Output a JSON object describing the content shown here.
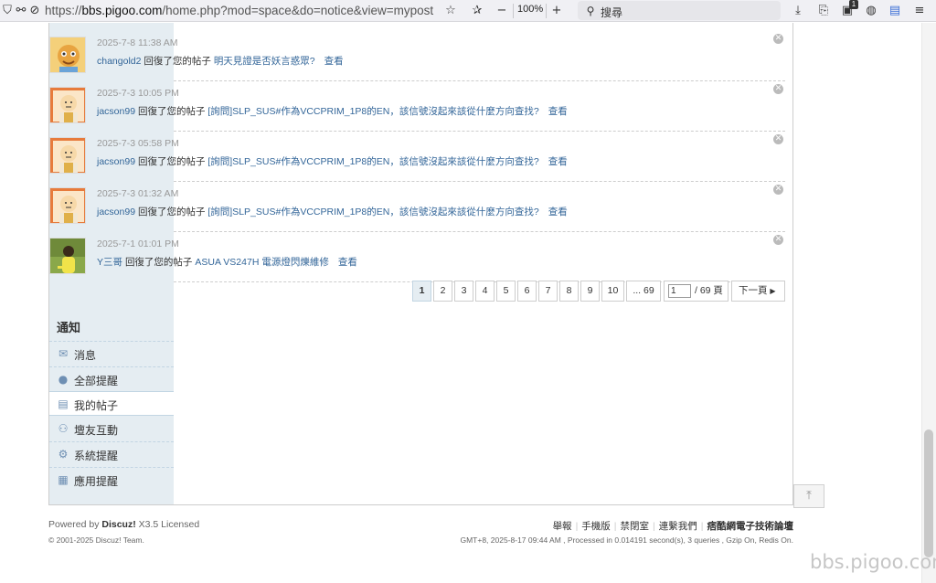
{
  "browser": {
    "url_prefix": "https://",
    "url_host": "bbs.pigoo.com",
    "url_path": "/home.php?mod=space&do=notice&view=mypost",
    "zoom": "100%",
    "search_placeholder": "搜尋",
    "extension_badge": "1"
  },
  "notices": [
    {
      "time": "2025-7-8 11:38 AM",
      "user": "changold2",
      "action": "回復了您的帖子",
      "thread": "明天見證是否妖言惑眾?",
      "view": "查看"
    },
    {
      "time": "2025-7-3 10:05 PM",
      "user": "jacson99",
      "action": "回復了您的帖子",
      "thread": "[詢問]SLP_SUS#作為VCCPRIM_1P8的EN，該信號沒起來該從什麼方向查找?",
      "view": "查看"
    },
    {
      "time": "2025-7-3 05:58 PM",
      "user": "jacson99",
      "action": "回復了您的帖子",
      "thread": "[詢問]SLP_SUS#作為VCCPRIM_1P8的EN，該信號沒起來該從什麼方向查找?",
      "view": "查看"
    },
    {
      "time": "2025-7-3 01:32 AM",
      "user": "jacson99",
      "action": "回復了您的帖子",
      "thread": "[詢問]SLP_SUS#作為VCCPRIM_1P8的EN，該信號沒起來該從什麼方向查找?",
      "view": "查看"
    },
    {
      "time": "2025-7-1 01:01 PM",
      "user": "Y三哥",
      "action": "回復了您的帖子",
      "thread": "ASUA VS247H 電源燈閃爍維修",
      "view": "查看"
    }
  ],
  "pagination": {
    "pages": [
      "1",
      "2",
      "3",
      "4",
      "5",
      "6",
      "7",
      "8",
      "9",
      "10",
      "... 69"
    ],
    "current": "1",
    "input_value": "1",
    "total": "/ 69 頁",
    "next": "下一頁"
  },
  "sidebar": {
    "title": "通知",
    "items": [
      {
        "label": "消息",
        "icon": "envelope-icon"
      },
      {
        "label": "全部提醒",
        "icon": "person-icon"
      },
      {
        "label": "我的帖子",
        "icon": "posts-icon",
        "active": true
      },
      {
        "label": "壇友互動",
        "icon": "interaction-icon"
      },
      {
        "label": "系統提醒",
        "icon": "gear-icon"
      },
      {
        "label": "應用提醒",
        "icon": "calendar-icon"
      }
    ]
  },
  "footer": {
    "powered_prefix": "Powered by",
    "powered_brand": "Discuz!",
    "powered_version": "X3.5 Licensed",
    "copyright": "© 2001-2025 Discuz! Team.",
    "links": [
      "舉報",
      "手機版",
      "禁閉室",
      "連繫我們"
    ],
    "site_name": "痞酷網電子技術論壇",
    "stats": "GMT+8, 2025-8-17 09:44 AM , Processed in 0.014191 second(s), 3 queries , Gzip On, Redis On."
  },
  "watermark": "bbs.pigoo.com"
}
